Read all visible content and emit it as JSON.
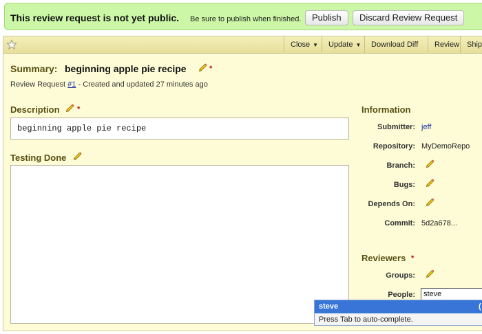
{
  "banner": {
    "title": "This review request is not yet public.",
    "note": "Be sure to publish when finished.",
    "publish_label": "Publish",
    "discard_label": "Discard Review Request"
  },
  "actions": {
    "close": "Close",
    "update": "Update",
    "download_diff": "Download Diff",
    "review": "Review",
    "ship": "Ship"
  },
  "summary": {
    "label": "Summary:",
    "text": "beginning apple pie recipe"
  },
  "meta": {
    "prefix": "Review Request",
    "link": "#1",
    "suffix": "- Created and updated 27 minutes ago"
  },
  "description": {
    "title": "Description",
    "text": "beginning apple pie recipe"
  },
  "testing_done": {
    "title": "Testing Done",
    "text": ""
  },
  "information": {
    "title": "Information",
    "submitter_label": "Submitter:",
    "submitter_value": "jeff",
    "repository_label": "Repository:",
    "repository_value": "MyDemoRepo",
    "branch_label": "Branch:",
    "bugs_label": "Bugs:",
    "depends_label": "Depends On:",
    "commit_label": "Commit:",
    "commit_value": "5d2a678..."
  },
  "reviewers": {
    "title": "Reviewers",
    "groups_label": "Groups:",
    "people_label": "People:",
    "people_value": "steve"
  },
  "autocomplete": {
    "item": "steve",
    "paren": "(",
    "hint": "Press Tab to auto-complete."
  },
  "icons": {
    "edit": "pencil-icon",
    "star": "star-icon"
  },
  "colors": {
    "banner_bg": "#ccf7a6",
    "panel_bg": "#fdfcd6",
    "heading": "#575012",
    "required": "#bb1111",
    "link": "#1a2ea8",
    "ac_highlight": "#3875d7"
  }
}
